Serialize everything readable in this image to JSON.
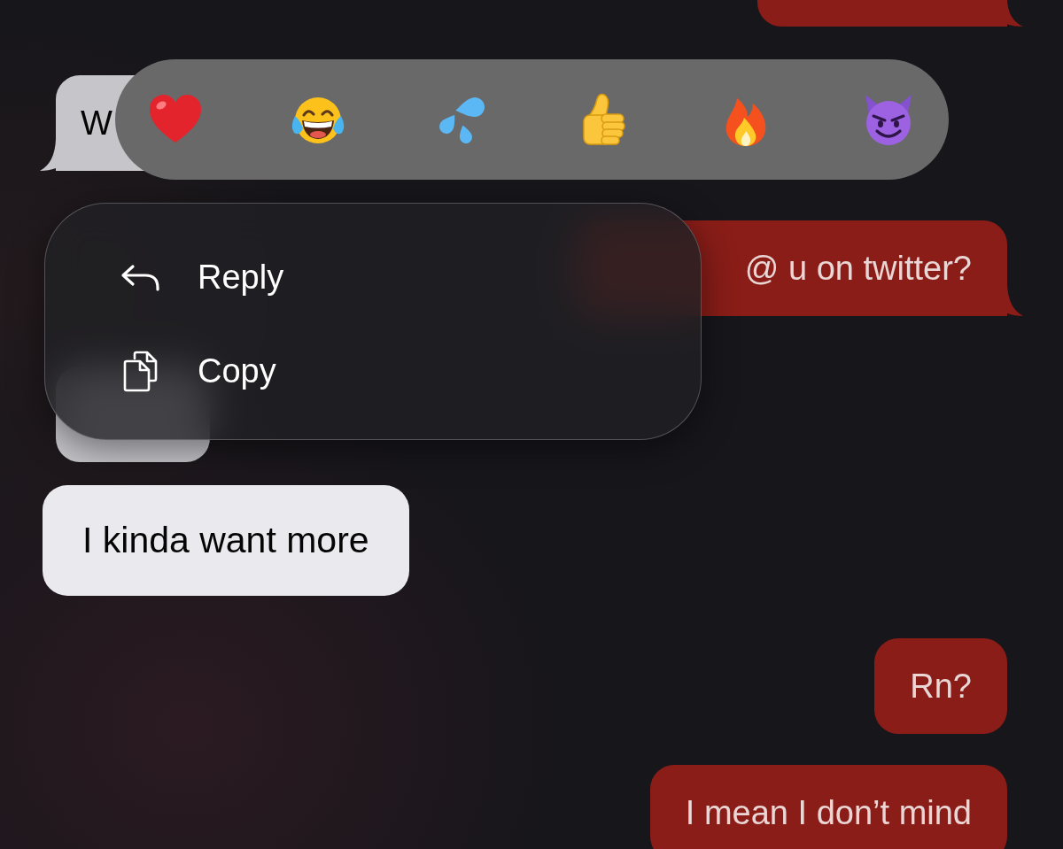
{
  "messages": [
    {
      "kind": "outgoing",
      "selected": false,
      "tail": true
    },
    {
      "kind": "incoming",
      "selected": false,
      "tail": true,
      "text": "W"
    },
    {
      "kind": "outgoing",
      "selected": false,
      "tail": true,
      "text": "@ u on twitter?"
    },
    {
      "kind": "incoming",
      "selected": false,
      "tail": false
    },
    {
      "kind": "incoming",
      "selected": true,
      "tail": false,
      "text": "I kinda want more"
    },
    {
      "kind": "outgoing",
      "selected": false,
      "tail": false,
      "text": "Rn?"
    },
    {
      "kind": "outgoing",
      "selected": false,
      "tail": false,
      "text": "I mean I don’t mind"
    }
  ],
  "reactions": [
    {
      "kind": "heart"
    },
    {
      "kind": "laughing"
    },
    {
      "kind": "droplets"
    },
    {
      "kind": "thumbs_up"
    },
    {
      "kind": "fire"
    },
    {
      "kind": "devil"
    }
  ],
  "context_menu": {
    "items": [
      {
        "kind": "reply",
        "label": "Reply"
      },
      {
        "kind": "copy",
        "label": "Copy"
      }
    ]
  }
}
